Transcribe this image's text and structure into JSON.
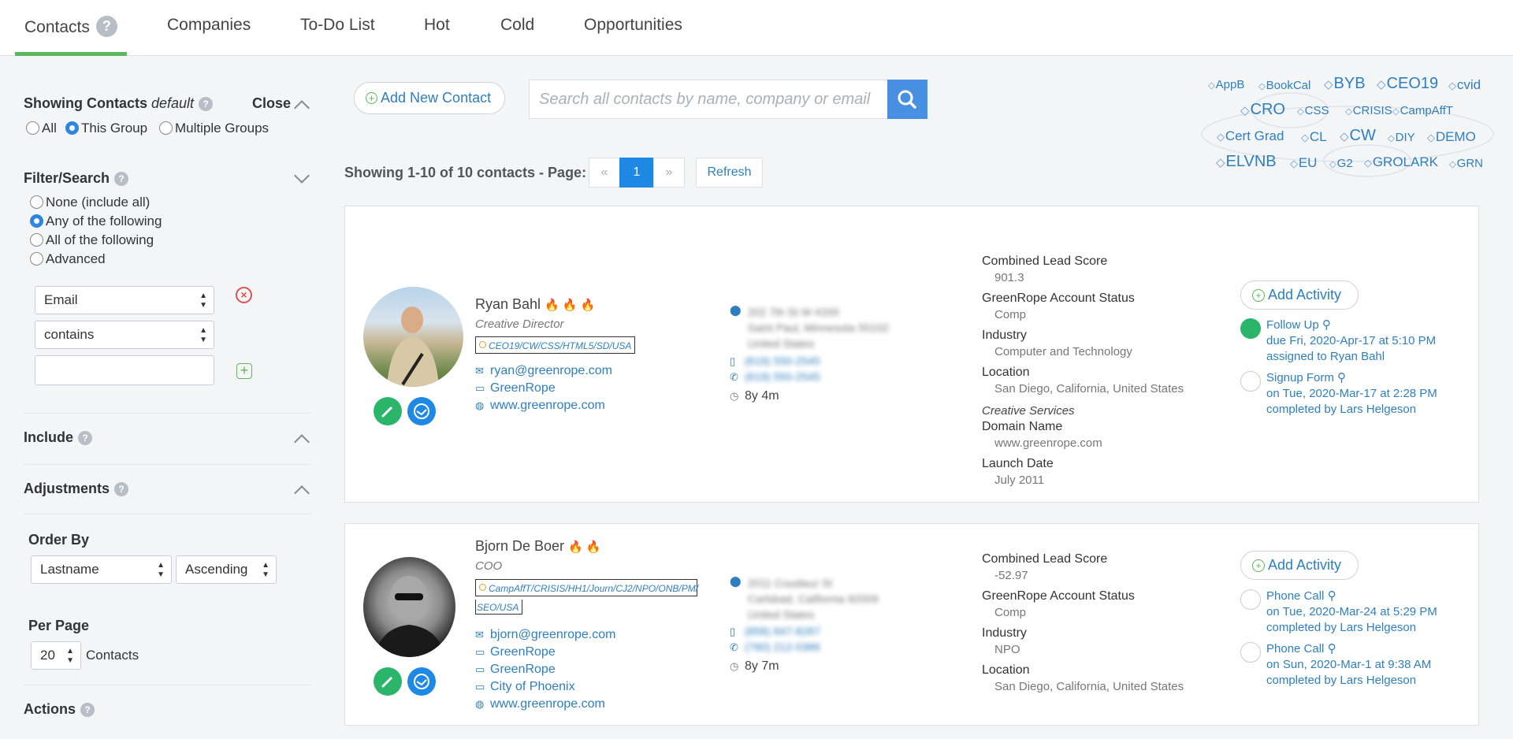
{
  "nav": {
    "tabs": [
      "Contacts",
      "Companies",
      "To-Do List",
      "Hot",
      "Cold",
      "Opportunities"
    ],
    "help": "?"
  },
  "sidebar": {
    "showing_title": "Showing Contacts",
    "showing_group": "default",
    "close": "Close",
    "group_options": [
      "All",
      "This Group",
      "Multiple Groups"
    ],
    "filter_title": "Filter/Search",
    "filter_options": [
      "None (include all)",
      "Any of the following",
      "All of the following",
      "Advanced"
    ],
    "field_select": "Email",
    "operator_select": "contains",
    "include_title": "Include",
    "adjustments_title": "Adjustments",
    "order_by_label": "Order By",
    "order_field": "Lastname",
    "order_dir": "Ascending",
    "per_page_label": "Per Page",
    "per_page_value": "20",
    "per_page_unit": "Contacts",
    "actions_title": "Actions"
  },
  "main": {
    "add_contact": "Add New Contact",
    "search_placeholder": "Search all contacts by name, company or email",
    "showing_text": "Showing 1-10 of 10 contacts - Page:",
    "pager": {
      "prev": "«",
      "current": "1",
      "next": "»"
    },
    "refresh": "Refresh"
  },
  "tag_cloud": [
    "AppB",
    "BookCal",
    "BYB",
    "CEO19",
    "cvid",
    "CRO",
    "CSS",
    "CRISIS",
    "CampAffT",
    "Cert Grad",
    "CL",
    "CW",
    "DIY",
    "DEMO",
    "ELVNB",
    "EU",
    "G2",
    "GROLARK",
    "GRN"
  ],
  "contacts": [
    {
      "name": "Ryan Bahl",
      "flames": "🔥 🔥 🔥",
      "title": "Creative Director",
      "tags": "CEO19/CW/CSS/HTML5/SD/USA",
      "email": "ryan@greenrope.com",
      "company": "GreenRope",
      "website": "www.greenrope.com",
      "address": [
        "202 7th St W #200",
        "Saint Paul, Minnesota 55102",
        "United States"
      ],
      "phone1": "(619) 550-2545",
      "phone2": "(619) 550-2545",
      "age": "8y 4m",
      "fields": [
        {
          "label": "Combined Lead Score",
          "value": "901.3"
        },
        {
          "label": "GreenRope Account Status",
          "value": "Comp"
        },
        {
          "label": "Industry",
          "value": "Computer and Technology"
        },
        {
          "label": "Location",
          "value": "San Diego, California, United States"
        }
      ],
      "section": "Creative Services",
      "fields2": [
        {
          "label": "Domain Name",
          "value": "www.greenrope.com"
        },
        {
          "label": "Launch Date",
          "value": "July 2011"
        }
      ],
      "add_activity": "Add Activity",
      "activities": [
        {
          "title": "Follow Up",
          "line1": "due Fri, 2020-Apr-17 at 5:10 PM",
          "line2": "assigned to Ryan Bahl",
          "active": true
        },
        {
          "title": "Signup Form",
          "line1": "on Tue, 2020-Mar-17 at 2:28 PM",
          "line2": "completed by Lars Helgeson",
          "active": false
        }
      ]
    },
    {
      "name": "Bjorn De Boer",
      "flames": "🔥 🔥",
      "title": "COO",
      "tags1": "CampAffT/CRISIS/HH1/Journ/CJ2/NPO/ONB/PM/",
      "tags2": "SEO/USA",
      "email": "bjorn@greenrope.com",
      "company": "GreenRope",
      "company2": "GreenRope",
      "company3": "City of Phoenix",
      "website": "www.greenrope.com",
      "address": [
        "2011 Coudauz St",
        "Carlsbad, California 92009",
        "United States"
      ],
      "phone1": "(858) 847-8287",
      "phone2": "(760) 212-0386",
      "age": "8y 7m",
      "fields": [
        {
          "label": "Combined Lead Score",
          "value": "-52.97"
        },
        {
          "label": "GreenRope Account Status",
          "value": "Comp"
        },
        {
          "label": "Industry",
          "value": "NPO"
        },
        {
          "label": "Location",
          "value": "San Diego, California, United States"
        }
      ],
      "add_activity": "Add Activity",
      "activities": [
        {
          "title": "Phone Call",
          "line1": "on Tue, 2020-Mar-24 at 5:29 PM",
          "line2": "completed by Lars Helgeson",
          "active": false
        },
        {
          "title": "Phone Call",
          "line1": "on Sun, 2020-Mar-1 at 9:38 AM",
          "line2": "completed by Lars Helgeson",
          "active": false
        }
      ]
    }
  ],
  "colors": {
    "accent": "#5cb85c",
    "link": "#2e7fbf",
    "primary": "#4a90e2",
    "green_button": "#2bb56a",
    "blue_button": "#1e88e5"
  }
}
